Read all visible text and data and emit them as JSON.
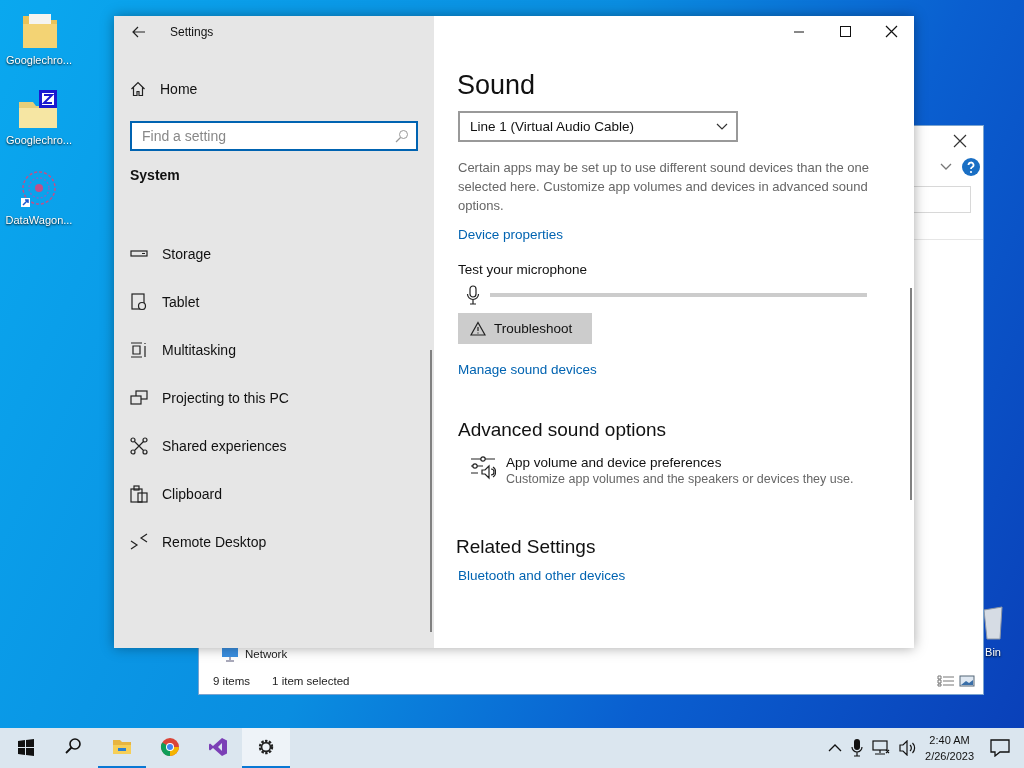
{
  "desktop_icons": [
    {
      "label": "Googlechro...",
      "kind": "folder"
    },
    {
      "label": "Googlechro...",
      "kind": "zip"
    },
    {
      "label": "DataWagon...",
      "kind": "app"
    }
  ],
  "recycle_bin": {
    "label": "Bin"
  },
  "explorer": {
    "nav_items": [
      {
        "label": "Network"
      }
    ],
    "status_bar": {
      "item_count": "9 items",
      "selection": "1 item selected"
    }
  },
  "settings": {
    "title": "Settings",
    "home": "Home",
    "search": {
      "placeholder": "Find a setting",
      "focused": true
    },
    "section": "System",
    "nav_items": [
      {
        "label": "Storage"
      },
      {
        "label": "Tablet"
      },
      {
        "label": "Multitasking"
      },
      {
        "label": "Projecting to this PC"
      },
      {
        "label": "Shared experiences"
      },
      {
        "label": "Clipboard"
      },
      {
        "label": "Remote Desktop"
      }
    ],
    "page": {
      "title": "Sound",
      "input_device": {
        "value": "Line 1 (Virtual Audio Cable)"
      },
      "description": "Certain apps may be set up to use different sound devices than the one selected here. Customize app volumes and devices in advanced sound options.",
      "device_properties_link": "Device properties",
      "mic_test": {
        "label": "Test your microphone",
        "level": 0
      },
      "troubleshoot_button": "Troubleshoot",
      "manage_link": "Manage sound devices",
      "advanced": {
        "heading": "Advanced sound options",
        "items": [
          {
            "title": "App volume and device preferences",
            "subtitle": "Customize app volumes and the speakers or devices they use."
          }
        ]
      },
      "related": {
        "heading": "Related Settings",
        "links": [
          "Bluetooth and other devices"
        ]
      }
    }
  },
  "taskbar": {
    "apps": [
      {
        "kind": "start",
        "running": false,
        "selected": false
      },
      {
        "kind": "search",
        "running": false,
        "selected": false
      },
      {
        "kind": "explorer",
        "running": true,
        "selected": false
      },
      {
        "kind": "chrome",
        "running": false,
        "selected": false
      },
      {
        "kind": "studio",
        "running": false,
        "selected": false
      },
      {
        "kind": "settings",
        "running": true,
        "selected": true
      }
    ],
    "clock": {
      "time": "2:40 AM",
      "date": "2/26/2023"
    }
  }
}
